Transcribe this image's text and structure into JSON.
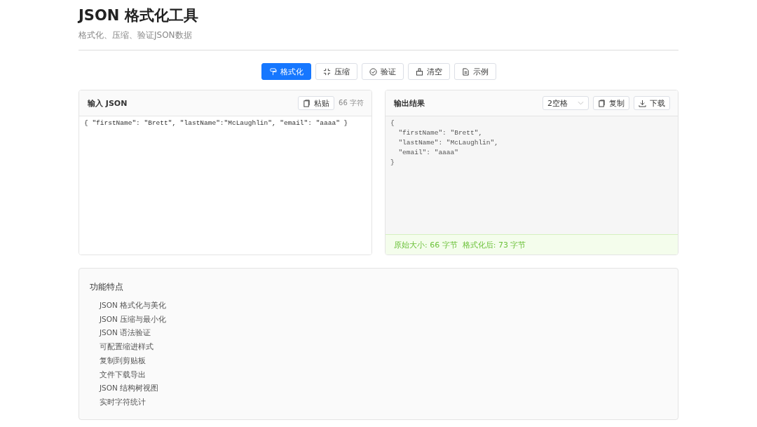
{
  "header": {
    "title": "JSON 格式化工具",
    "subtitle": "格式化、压缩、验证JSON数据"
  },
  "toolbar": [
    {
      "kind": "format",
      "label": "格式化",
      "selected": true
    },
    {
      "kind": "compress",
      "label": "压缩",
      "selected": false
    },
    {
      "kind": "validate",
      "label": "验证",
      "selected": false
    },
    {
      "kind": "clear",
      "label": "清空",
      "selected": false
    },
    {
      "kind": "example",
      "label": "示例",
      "selected": false
    }
  ],
  "input_panel": {
    "title": "输入 JSON",
    "paste_button": "粘贴",
    "char_count": "66 字符",
    "value": "{ \"firstName\": \"Brett\", \"lastName\":\"McLaughlin\", \"email\": \"aaaa\" }"
  },
  "output_panel": {
    "title": "输出结果",
    "indent_select": "2空格",
    "copy_button": "复制",
    "download_button": "下载",
    "value": "{\n  \"firstName\": \"Brett\",\n  \"lastName\": \"McLaughlin\",\n  \"email\": \"aaaa\"\n}",
    "status": "原始大小: 66 字节  格式化后: 73 字节"
  },
  "features": {
    "title": "功能特点",
    "items": [
      "JSON 格式化与美化",
      "JSON 压缩与最小化",
      "JSON 语法验证",
      "可配置缩进样式",
      "复制到剪贴板",
      "文件下载导出",
      "JSON 结构树视图",
      "实时字符统计"
    ]
  }
}
